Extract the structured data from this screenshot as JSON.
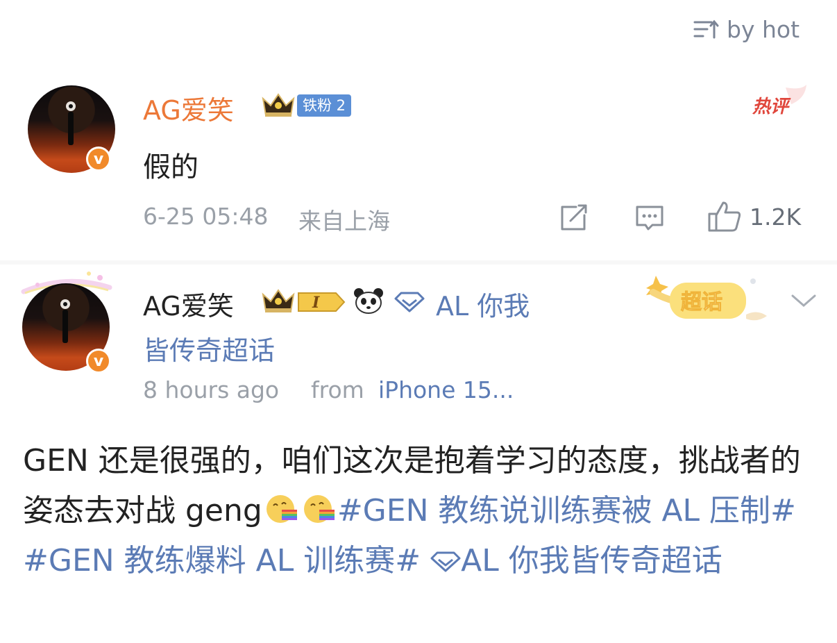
{
  "sort": {
    "label": "by hot"
  },
  "comment": {
    "username": "AG爱笑",
    "fan_badge": "铁粉 2",
    "hot_tag": "热评",
    "text": "假的",
    "timestamp": "6-25 05:48",
    "location": "来自上海",
    "likes": "1.2K"
  },
  "post": {
    "username": "AG爱笑",
    "level_badge": "I",
    "supertopic_line1": "AL 你我",
    "supertopic_line2": "皆传奇超话",
    "supertopic_tag": "超话",
    "time": "8 hours ago",
    "from_label": "from",
    "device": "iPhone 15...",
    "body_text": "GEN 还是很强的，咱们这次是抱着学习的态度，挑战者的姿态去对战 geng",
    "hashtag1": "#GEN 教练说训练赛被 AL 压制#",
    "hashtag2": "#GEN 教练爆料 AL 训练赛#",
    "supertopic_link": "AL 你我皆传奇超话"
  },
  "colors": {
    "accent": "#ec7838",
    "link": "#5b7bb5",
    "meta": "#9aa0a8",
    "verified": "#f18a2a"
  }
}
